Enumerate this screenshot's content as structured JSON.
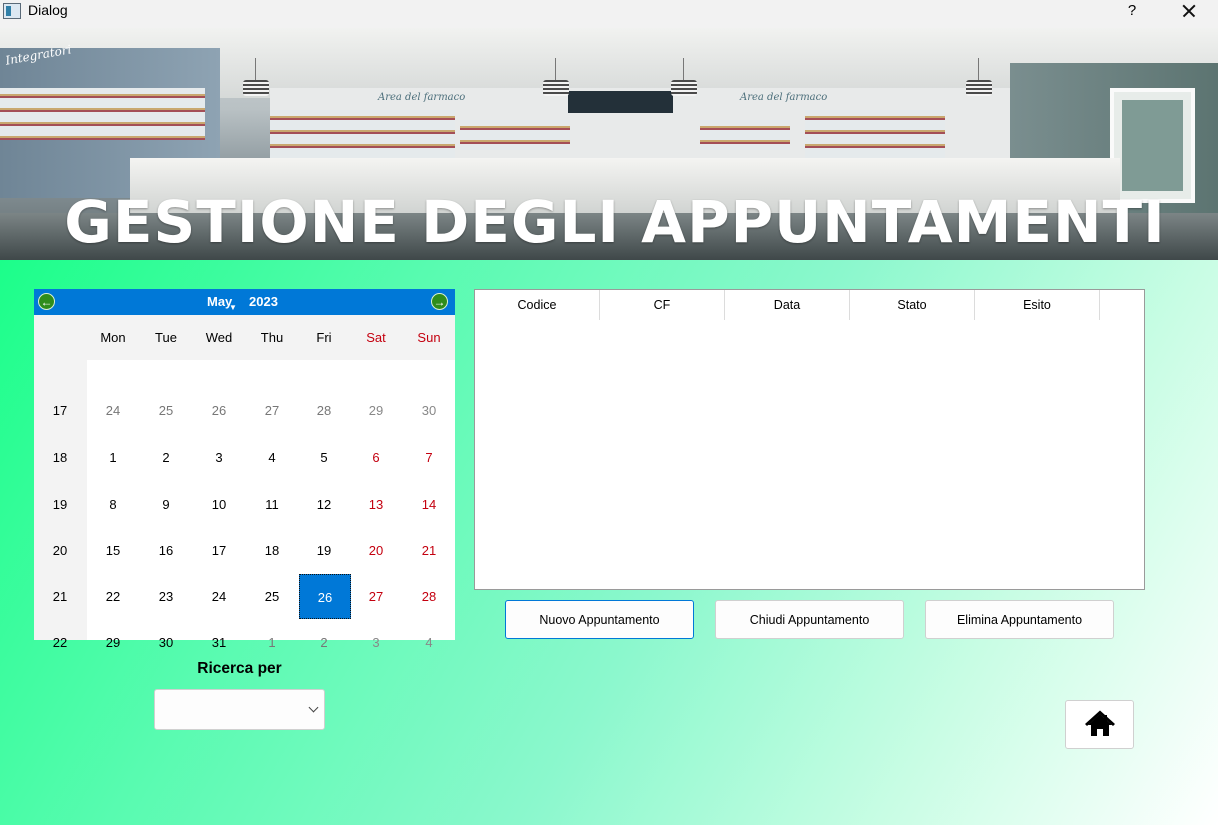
{
  "window": {
    "title": "Dialog",
    "help_label": "?"
  },
  "banner": {
    "title": "GESTIONE DEGLI APPUNTAMENTI",
    "sign_left": "Integratori",
    "sign_center": "Area del farmaco",
    "sign_right": "Area del farmaco"
  },
  "calendar": {
    "month": "May",
    "year": "2023",
    "prev_icon": "arrow-left-icon",
    "next_icon": "arrow-right-icon",
    "days_of_week": [
      "Mon",
      "Tue",
      "Wed",
      "Thu",
      "Fri",
      "Sat",
      "Sun"
    ],
    "weeks": [
      {
        "week": "17",
        "days": [
          "24",
          "25",
          "26",
          "27",
          "28",
          "29",
          "30"
        ]
      },
      {
        "week": "18",
        "days": [
          "1",
          "2",
          "3",
          "4",
          "5",
          "6",
          "7"
        ]
      },
      {
        "week": "19",
        "days": [
          "8",
          "9",
          "10",
          "11",
          "12",
          "13",
          "14"
        ]
      },
      {
        "week": "20",
        "days": [
          "15",
          "16",
          "17",
          "18",
          "19",
          "20",
          "21"
        ]
      },
      {
        "week": "21",
        "days": [
          "22",
          "23",
          "24",
          "25",
          "26",
          "27",
          "28"
        ]
      },
      {
        "week": "22",
        "days": [
          "29",
          "30",
          "31",
          "1",
          "2",
          "3",
          "4"
        ]
      }
    ],
    "selected_date": "26",
    "weekend_color": "#c4000f",
    "accent_color": "#0078d7"
  },
  "table": {
    "columns": [
      "Codice",
      "CF",
      "Data",
      "Stato",
      "Esito"
    ],
    "rows": []
  },
  "actions": {
    "new_label": "Nuovo Appuntamento",
    "close_label": "Chiudi Appuntamento",
    "delete_label": "Elimina Appuntamento"
  },
  "search": {
    "label": "Ricerca per",
    "selected_value": ""
  },
  "home": {
    "icon": "home-icon"
  }
}
